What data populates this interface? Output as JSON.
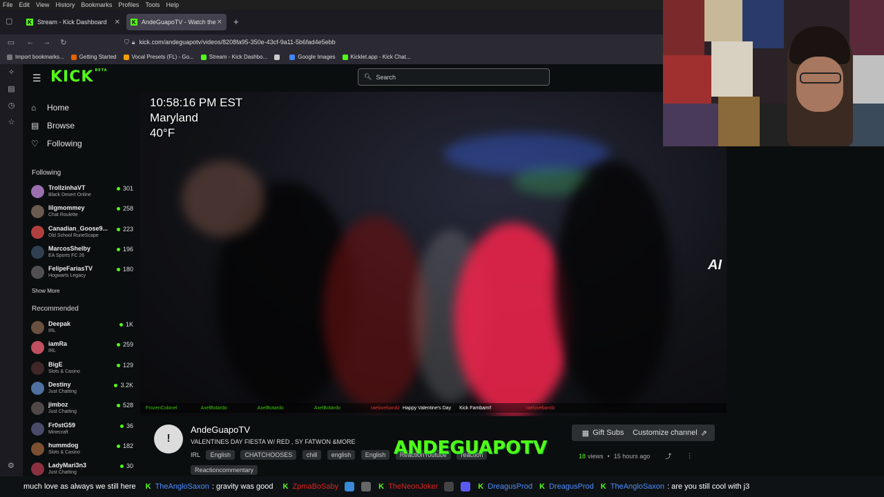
{
  "browser": {
    "menu": [
      "File",
      "Edit",
      "View",
      "History",
      "Bookmarks",
      "Profiles",
      "Tools",
      "Help"
    ],
    "tabs": [
      {
        "label": "Stream - Kick Dashboard",
        "active": false
      },
      {
        "label": "AndeGuapoTV - Watch the VOD",
        "active": true
      }
    ],
    "new_tab": "+",
    "url": "kick.com/andeguapotv/videos/8208fa95-350e-43cf-9a11-5b6fad4e5ebb",
    "bookmarks": [
      "Import bookmarks...",
      "Getting Started",
      "Vocal Presets (FL) - Go...",
      "Stream - Kick Dashbo...",
      "Google Images",
      "Kicklet.app - Kick Chat..."
    ]
  },
  "kick": {
    "logo": "KICK",
    "logo_beta": "BETA",
    "search_placeholder": "Search",
    "nav": [
      {
        "label": "Home",
        "icon": "home-icon"
      },
      {
        "label": "Browse",
        "icon": "browse-icon"
      },
      {
        "label": "Following",
        "icon": "heart-icon"
      }
    ],
    "following_title": "Following",
    "following": [
      {
        "name": "TrollzinhaVT",
        "category": "Black Desert Online",
        "viewers": "301",
        "color": "#9a6fb0"
      },
      {
        "name": "lilgmommey",
        "category": "Chat Roulette",
        "viewers": "258",
        "color": "#6a5a50"
      },
      {
        "name": "Canadian_Goose9...",
        "category": "Old School RuneScape",
        "viewers": "223",
        "color": "#b04040"
      },
      {
        "name": "MarcosShelby",
        "category": "EA Sports FC 26",
        "viewers": "196",
        "color": "#304050"
      },
      {
        "name": "FelipeFariasTV",
        "category": "Hogwarts Legacy",
        "viewers": "180",
        "color": "#505050"
      }
    ],
    "show_more": "Show More",
    "recommended_title": "Recommended",
    "recommended": [
      {
        "name": "Deepak",
        "category": "IRL",
        "viewers": "1K",
        "color": "#6a5040"
      },
      {
        "name": "iamRa",
        "category": "IRL",
        "viewers": "259",
        "color": "#c05060"
      },
      {
        "name": "BigE",
        "category": "Slots & Casino",
        "viewers": "129",
        "color": "#402828"
      },
      {
        "name": "Destiny",
        "category": "Just Chatting",
        "viewers": "3.2K",
        "color": "#5070a0"
      },
      {
        "name": "jimboz",
        "category": "Just Chatting",
        "viewers": "528",
        "color": "#504848"
      },
      {
        "name": "Fr0stG59",
        "category": "Minecraft",
        "viewers": "36",
        "color": "#4a4a6a"
      },
      {
        "name": "hummdog",
        "category": "Slots & Casino",
        "viewers": "182",
        "color": "#7a5030"
      },
      {
        "name": "LadyMari3n3",
        "category": "Just Chatting",
        "viewers": "30",
        "color": "#8a3040"
      }
    ]
  },
  "video": {
    "overlay_time": "10:58:16 PM EST",
    "overlay_location": "Maryland",
    "overlay_temp": "40°F",
    "corner_text": "AI",
    "chat": [
      {
        "user": "FrozenColonel",
        "msg": ""
      },
      {
        "user": "AxelBotardo",
        "msg": ""
      },
      {
        "user": "AxelBotardo",
        "msg": ""
      },
      {
        "user": "AxelBotardo",
        "msg": ""
      },
      {
        "user": "raelovebandz",
        "msg": "Happy Valentine's Day",
        "extra": "Kick Fambam!!"
      },
      {
        "user": "raelovebandz",
        "msg": ""
      }
    ]
  },
  "channel": {
    "avatar_letter": "!",
    "name": "AndeGuapoTV",
    "title": "VALENTINES DAY FIESTA W/ RED , SY FATWON &MORE",
    "tags": [
      "IRL",
      "English",
      "CHATCHOOSES",
      "chill",
      "english",
      "English",
      "ReactionYoutube",
      "reaction",
      "Reactioncommentary"
    ],
    "gift_subs": "Gift Subs",
    "customize": "Customize channel",
    "views": "18",
    "views_label": "views",
    "time_ago": "15 hours ago",
    "overlay_name": "ANDEGUAPOTV"
  },
  "ticker": [
    {
      "type": "msg",
      "text": "much love as always we still here"
    },
    {
      "type": "user",
      "text": "TheAngloSaxon"
    },
    {
      "type": "msg",
      "text": ": gravity was good"
    },
    {
      "type": "red",
      "text": "ZpmaBoSaby"
    },
    {
      "type": "red",
      "text": "TheNeonJoker"
    },
    {
      "type": "user",
      "text": "DreagusProd"
    },
    {
      "type": "user",
      "text": "DreagusProd"
    },
    {
      "type": "user",
      "text": "TheAngloSaxon"
    },
    {
      "type": "msg",
      "text": ": are you still cool with j3"
    }
  ]
}
